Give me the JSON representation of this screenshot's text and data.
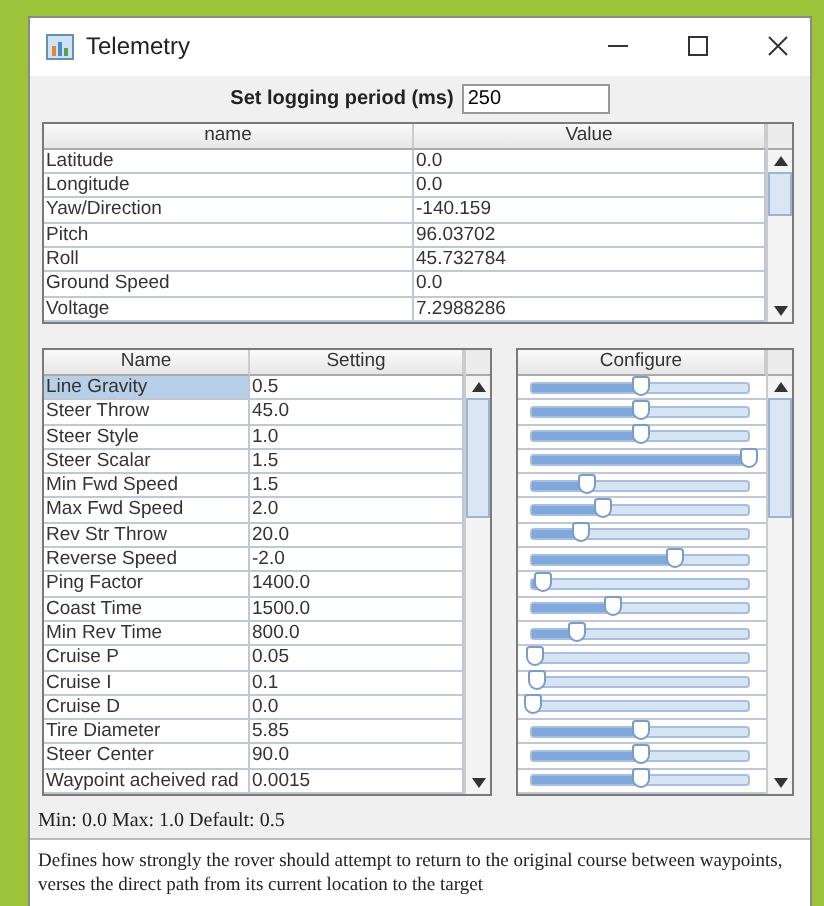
{
  "window": {
    "title": "Telemetry"
  },
  "logging": {
    "label": "Set logging period (ms)",
    "value": "250"
  },
  "telemetry": {
    "columns": [
      "name",
      "Value"
    ],
    "rows": [
      {
        "name": "Latitude",
        "value": "0.0"
      },
      {
        "name": "Longitude",
        "value": "0.0"
      },
      {
        "name": "Yaw/Direction",
        "value": "-140.159"
      },
      {
        "name": "Pitch",
        "value": "96.03702"
      },
      {
        "name": "Roll",
        "value": "45.732784"
      },
      {
        "name": "Ground Speed",
        "value": "0.0"
      },
      {
        "name": "Voltage",
        "value": "7.2988286"
      }
    ]
  },
  "settings": {
    "columns": [
      "Name",
      "Setting"
    ],
    "configure_title": "Configure",
    "rows": [
      {
        "name": "Line Gravity",
        "setting": "0.5",
        "selected": true,
        "level": 0.5
      },
      {
        "name": "Steer Throw",
        "setting": "45.0",
        "selected": false,
        "level": 0.5
      },
      {
        "name": "Steer Style",
        "setting": "1.0",
        "selected": false,
        "level": 0.5
      },
      {
        "name": "Steer Scalar",
        "setting": "1.5",
        "selected": false,
        "level": 1.0
      },
      {
        "name": "Min Fwd Speed",
        "setting": "1.5",
        "selected": false,
        "level": 0.25
      },
      {
        "name": "Max Fwd Speed",
        "setting": "2.0",
        "selected": false,
        "level": 0.32
      },
      {
        "name": "Rev Str Throw",
        "setting": "20.0",
        "selected": false,
        "level": 0.22
      },
      {
        "name": "Reverse Speed",
        "setting": "-2.0",
        "selected": false,
        "level": 0.66
      },
      {
        "name": "Ping Factor",
        "setting": "1400.0",
        "selected": false,
        "level": 0.05
      },
      {
        "name": "Coast Time",
        "setting": "1500.0",
        "selected": false,
        "level": 0.37
      },
      {
        "name": "Min Rev Time",
        "setting": "800.0",
        "selected": false,
        "level": 0.2
      },
      {
        "name": "Cruise P",
        "setting": "0.05",
        "selected": false,
        "level": 0.01
      },
      {
        "name": "Cruise I",
        "setting": "0.1",
        "selected": false,
        "level": 0.02
      },
      {
        "name": "Cruise D",
        "setting": "0.0",
        "selected": false,
        "level": 0.0
      },
      {
        "name": "Tire Diameter",
        "setting": "5.85",
        "selected": false,
        "level": 0.5
      },
      {
        "name": "Steer Center",
        "setting": "90.0",
        "selected": false,
        "level": 0.5
      },
      {
        "name": "Waypoint acheived rad",
        "setting": "0.0015",
        "selected": false,
        "level": 0.5
      }
    ]
  },
  "range_info": "Min: 0.0 Max: 1.0 Default: 0.5",
  "description": "Defines how strongly the rover should attempt to return to the original course between waypoints, verses the direct path from its current location to the target"
}
